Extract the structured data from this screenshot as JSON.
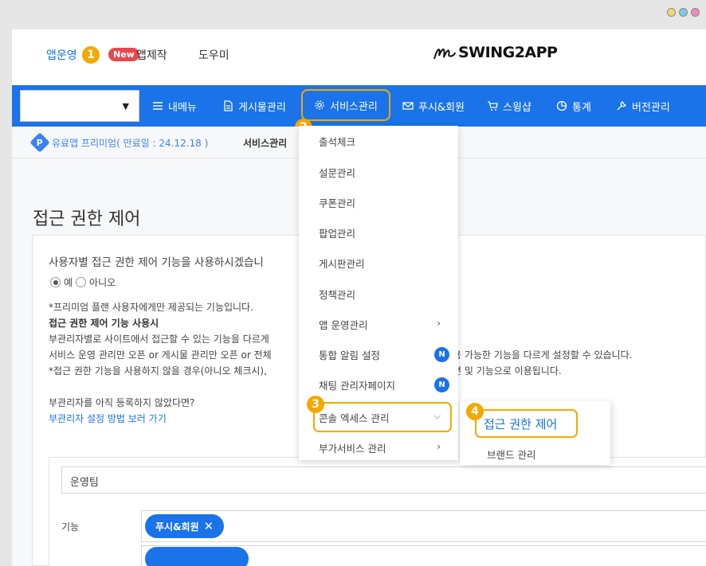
{
  "window_controls": {
    "colors": [
      "#f5d76e",
      "#7cc8e8",
      "#f08ab8"
    ]
  },
  "header": {
    "app_operation": "앱운영",
    "app_production": "앱제작",
    "new_badge": "New",
    "help": "도우미",
    "logo_text": "SWING2APP"
  },
  "annotations": {
    "one": "1",
    "two": "2",
    "three": "3",
    "four": "4"
  },
  "nav": {
    "select_value": "",
    "items": [
      "내메뉴",
      "게시물관리",
      "서비스관리",
      "푸시&회원",
      "스윙샵",
      "통계",
      "버전관리"
    ]
  },
  "subheader": {
    "premium_icon": "P",
    "premium": "유료앱 프리미엄( 만료일 : 24.12.18 )",
    "breadcrumb": "서비스관리"
  },
  "page": {
    "title": "접근 권한 제어",
    "question": "사용자별 접근 권한 제어 기능을 사용하시겠습니",
    "radio_yes": "예",
    "radio_no": "아니오",
    "line1": "*프리미엄 플랜 사용자에게만 제공되는 기능입니다.",
    "line2": "접근 권한 제어 기능 사용시",
    "line3": "부관리자별로 사이트에서 접근할 수 있는 기능을 다르게",
    "line4a": "서비스 운영 관리만 오픈 or 게시물 관리만 오픈 or 전체",
    "line4b": "용 가능한 기능을 다르게 설정할 수 있습니다.",
    "line5a": "*접근 권한 기능을 사용하지 않을 경우(아니오 체크시),",
    "line5b": "면 및 기능으로 이용됩니다.",
    "line6": "부관리자를 아직 등록하지 않았다면?",
    "link": "부관리자 설정 방법 보러 가기",
    "team": "운영팀",
    "func_label": "기능",
    "tag1": "푸시&회원"
  },
  "dropdown": {
    "items": [
      "출석체크",
      "설문관리",
      "쿠폰관리",
      "팝업관리",
      "게시판관리",
      "정책관리",
      "앱 운영관리",
      "통합 알림 설정",
      "채팅 관리자페이지",
      "콘솔 엑세스 관리",
      "부가서비스 관리"
    ],
    "n_badge": "N"
  },
  "submenu": {
    "items": [
      "접근 권한 제어",
      "브랜드 관리"
    ]
  },
  "colors": {
    "primary": "#1a73e8",
    "highlight": "#f5a800",
    "new_badge": "#e8484f"
  }
}
